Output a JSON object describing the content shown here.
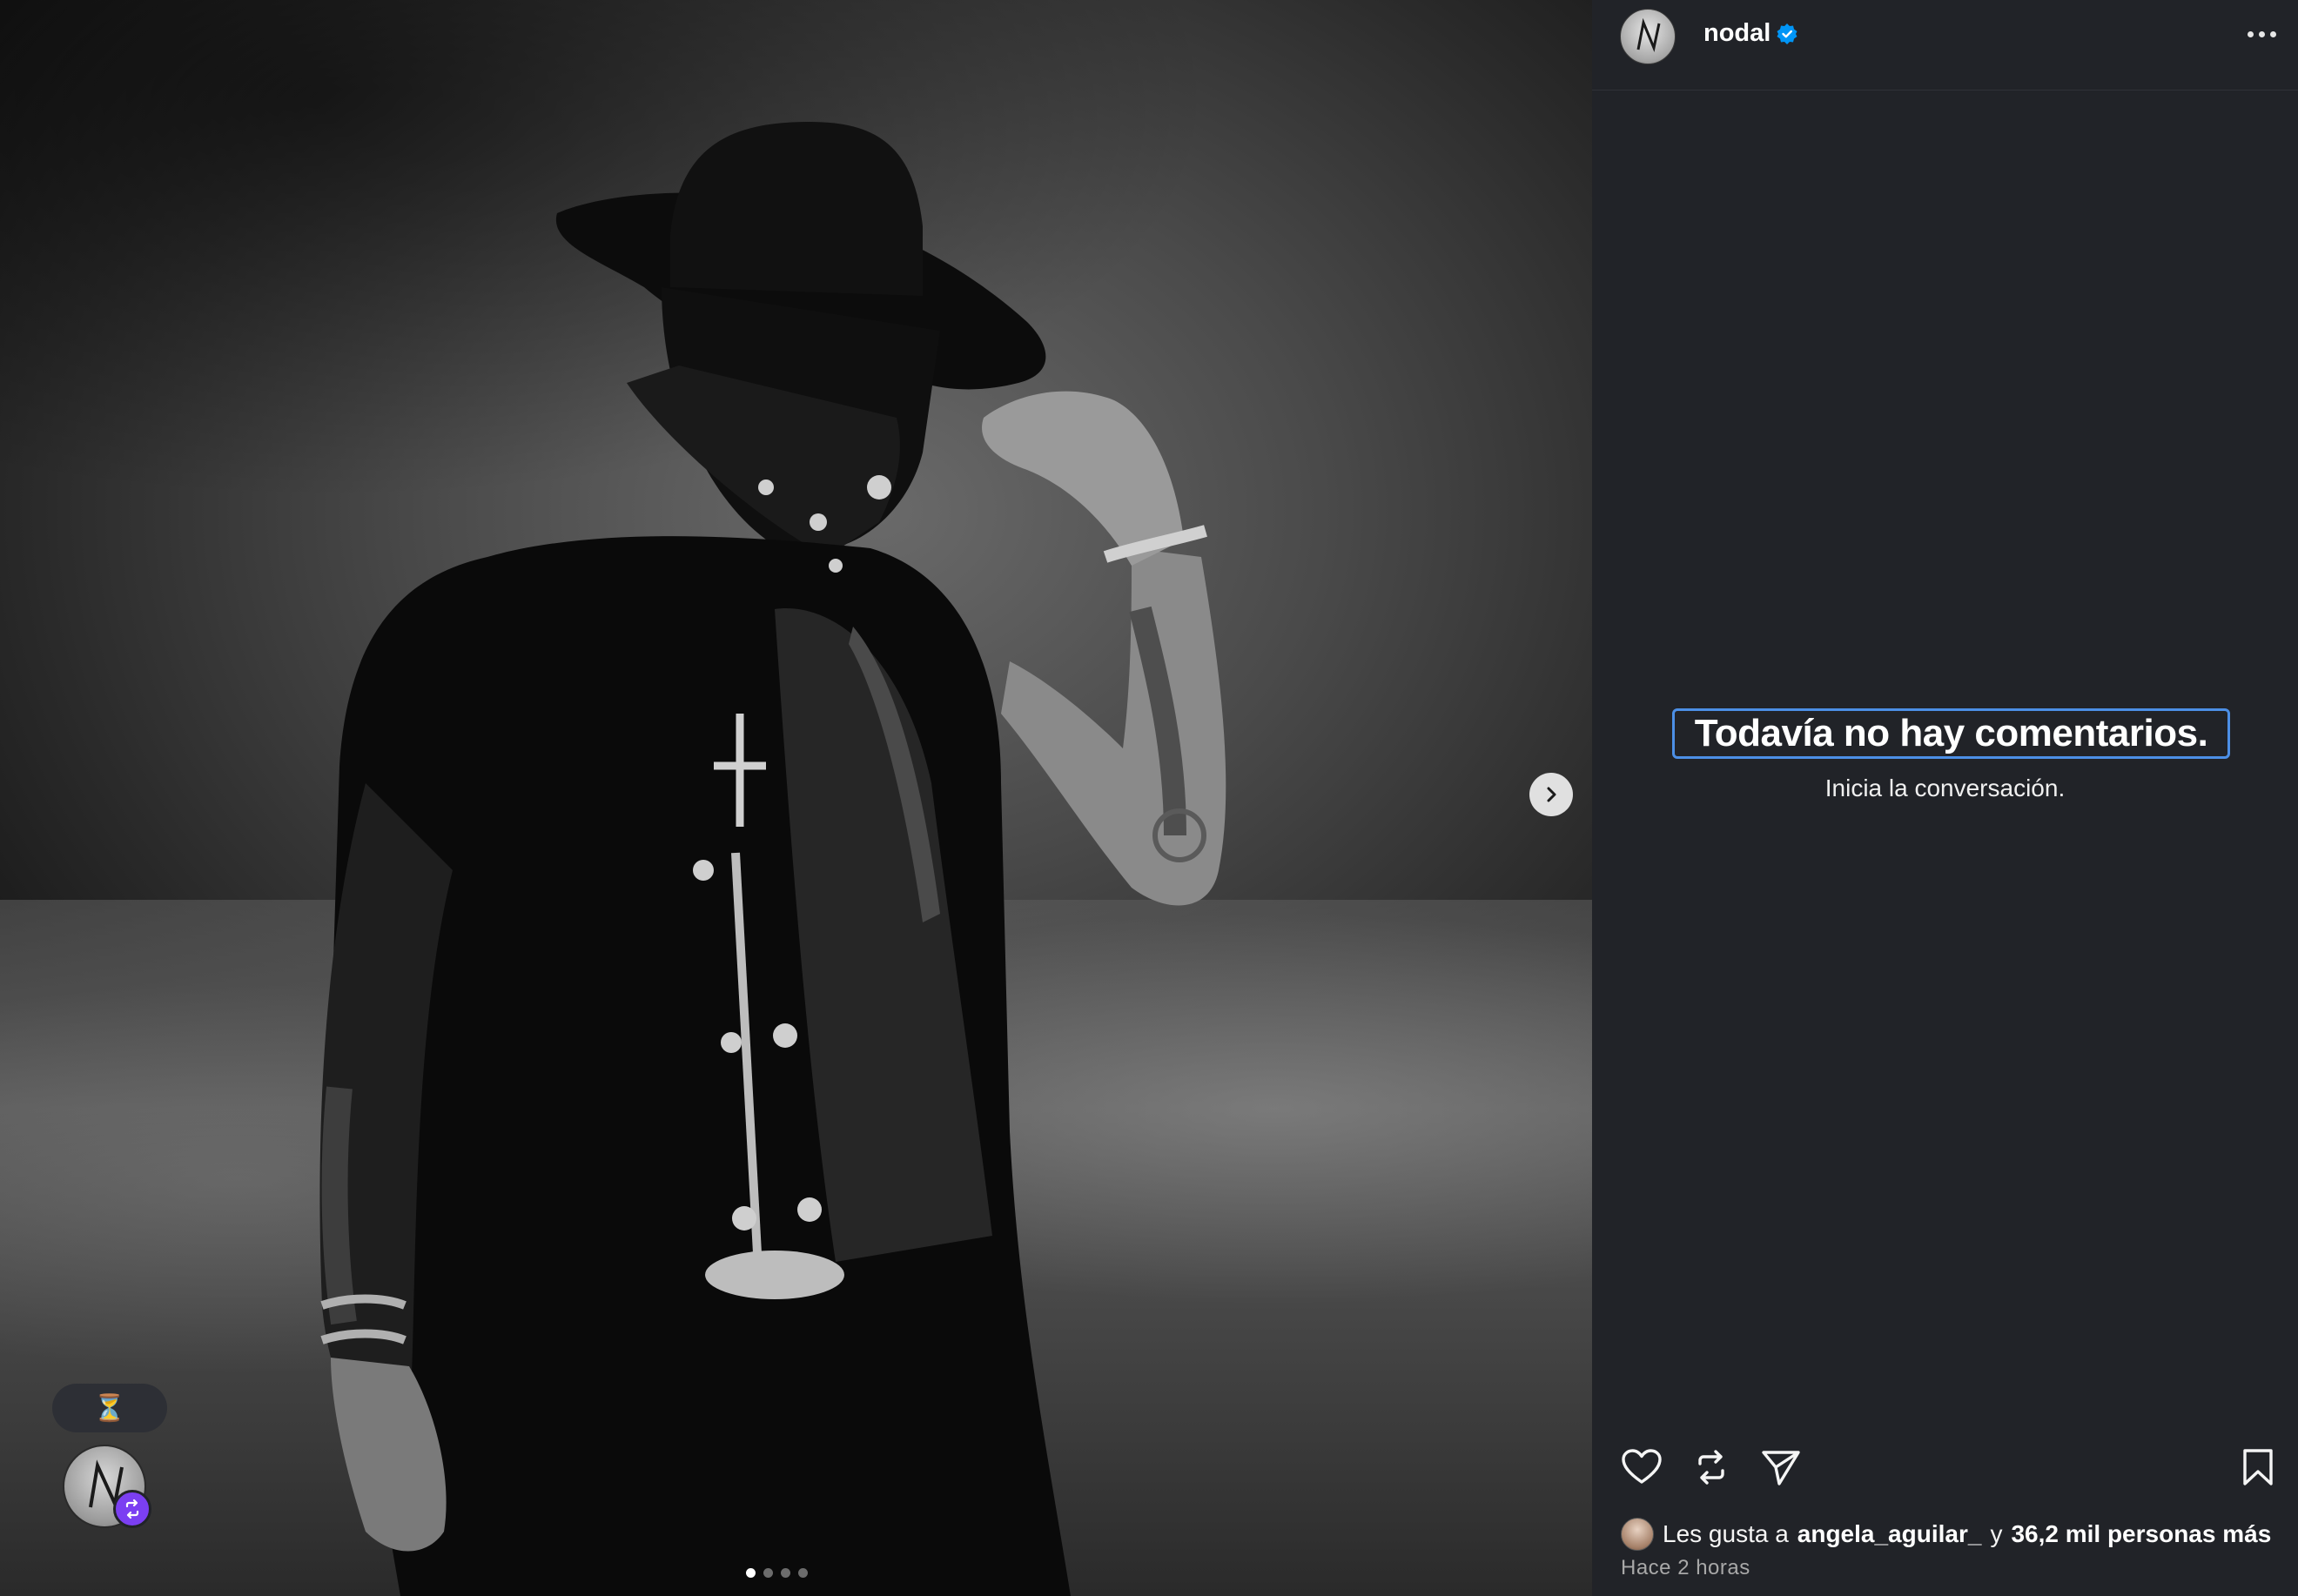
{
  "post": {
    "username": "nodal",
    "verified": true,
    "carousel": {
      "total_slides": 4,
      "active_slide": 1
    },
    "story_badge_icon": "hourglass-icon",
    "repost_icon": "repost-icon"
  },
  "comments": {
    "empty_title": "Todavía no hay comentarios.",
    "empty_subtitle": "Inicia la conversación."
  },
  "actions": {
    "like_icon": "heart-icon",
    "repost_icon": "repost-icon",
    "share_icon": "send-icon",
    "save_icon": "bookmark-icon"
  },
  "likes": {
    "prefix": "Les gusta a",
    "user": "angela_aguilar_",
    "joiner": "y",
    "others": "36,2 mil personas más"
  },
  "timestamp": "Hace 2 horas",
  "colors": {
    "panel_bg": "#212328",
    "focus_outline": "#4c8fe6",
    "verified_blue": "#0095f6",
    "repost_purple": "#7b3ff2"
  }
}
